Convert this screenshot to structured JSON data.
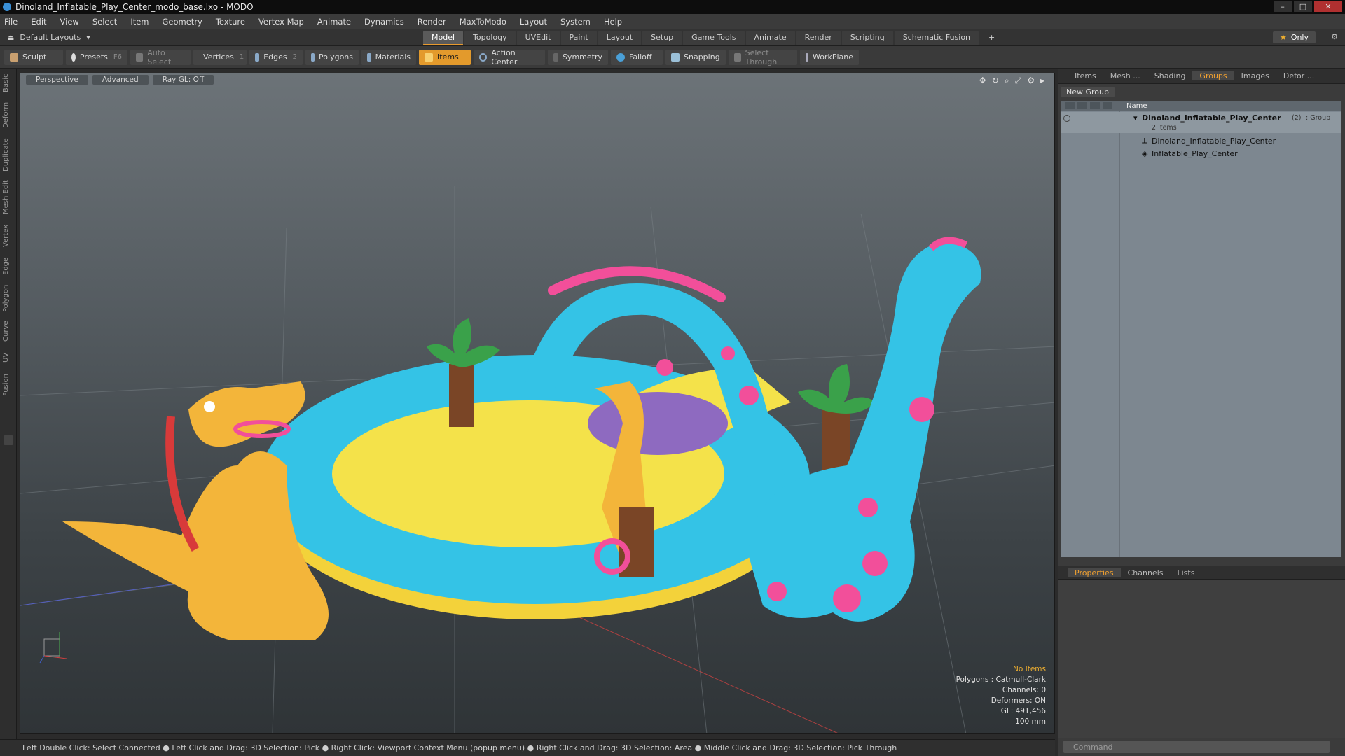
{
  "window": {
    "title": "Dinoland_Inflatable_Play_Center_modo_base.lxo - MODO",
    "buttons": [
      "–",
      "□",
      "✕"
    ]
  },
  "menu": [
    "File",
    "Edit",
    "View",
    "Select",
    "Item",
    "Geometry",
    "Texture",
    "Vertex Map",
    "Animate",
    "Dynamics",
    "Render",
    "MaxToModo",
    "Layout",
    "System",
    "Help"
  ],
  "layout_bar": {
    "layouts_label": "Default Layouts",
    "tabs": [
      "Model",
      "Topology",
      "UVEdit",
      "Paint",
      "Layout",
      "Setup",
      "Game Tools",
      "Animate",
      "Render",
      "Scripting",
      "Schematic Fusion"
    ],
    "active_tab": "Model",
    "add_tab": "+",
    "only_label": "Only"
  },
  "toolbar": {
    "sculpt": "Sculpt",
    "presets": "Presets",
    "presets_key": "F6",
    "auto_select": "Auto Select",
    "vertices": "Vertices",
    "vertices_count": "1",
    "edges": "Edges",
    "edges_count": "2",
    "polygons": "Polygons",
    "materials": "Materials",
    "items": "Items",
    "action_center": "Action Center",
    "symmetry": "Symmetry",
    "falloff": "Falloff",
    "snapping": "Snapping",
    "select_through": "Select Through",
    "workplane": "WorkPlane"
  },
  "left_tabs": [
    "Basic",
    "Deform",
    "Duplicate",
    "Mesh Edit",
    "Vertex",
    "Edge",
    "Polygon",
    "Curve",
    "UV",
    "Fusion"
  ],
  "viewport": {
    "mode": "Perspective",
    "shading": "Advanced",
    "raygl": "Ray GL: Off",
    "info": {
      "no_items": "No Items",
      "polygons": "Polygons : Catmull-Clark",
      "channels": "Channels: 0",
      "deformers": "Deformers: ON",
      "gl": "GL: 491,456",
      "scale": "100 mm"
    },
    "colors": {
      "cyan": "#34c3e6",
      "yellow": "#f4e24a",
      "orange": "#f3b53a",
      "pink": "#f24f9a",
      "purple": "#8e6ac0",
      "green": "#3aa14a",
      "brown": "#7a4526"
    }
  },
  "status": "Left Double Click: Select Connected ● Left Click and Drag: 3D Selection: Pick ● Right Click: Viewport Context Menu (popup menu) ● Right Click and Drag: 3D Selection: Area ● Middle Click and Drag: 3D Selection: Pick Through",
  "right_panel": {
    "tabs": [
      "Items",
      "Mesh ...",
      "Shading",
      "Groups",
      "Images",
      "Defor ..."
    ],
    "active_tab": "Groups",
    "new_group": "New Group",
    "column_name": "Name",
    "group": {
      "name": "Dinoland_Inflatable_Play_Center",
      "count": "(2)",
      "kind": ": Group",
      "items_count": "2 Items",
      "children": [
        "Dinoland_Inflatable_Play_Center",
        "Inflatable_Play_Center"
      ]
    },
    "prop_tabs": [
      "Properties",
      "Channels",
      "Lists"
    ],
    "active_prop_tab": "Properties",
    "command_placeholder": "Command"
  }
}
